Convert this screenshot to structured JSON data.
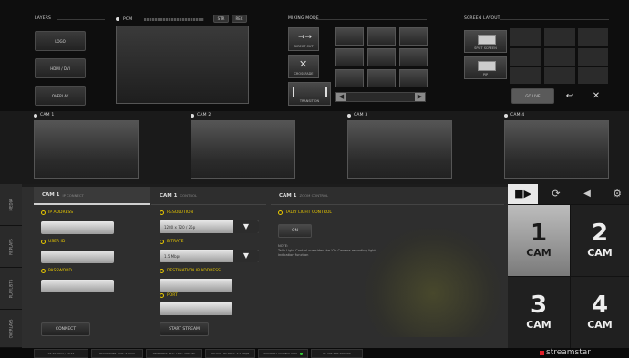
{
  "layers": {
    "title": "LAYERS",
    "buttons": [
      "LOGO",
      "HDMI / DVI",
      "OVERLAY"
    ]
  },
  "pcm": {
    "label": "PCM",
    "btn1": "STR",
    "btn2": "REC"
  },
  "mixing_mode": {
    "title": "MIXING MODE",
    "direct_cut": "DIRECT CUT",
    "crossfade": "CROSSFADE",
    "transition": "TRANSITION"
  },
  "screen_layout": {
    "title": "SCREEN LAYOUT",
    "split_screen": "SPLIT SCREEN",
    "pip": "PIP",
    "go_live": "GO LIVE"
  },
  "cameras": [
    "CAM 1",
    "CAM 2",
    "CAM 3",
    "CAM 4"
  ],
  "side_tabs": [
    "MEDIA",
    "REPLAYS",
    "PLAYLISTS",
    "OVERLAYS"
  ],
  "ip_panel": {
    "cam": "CAM 1",
    "title": "IP CONNECT",
    "ip_label": "IP ADDRESS",
    "user_label": "USER ID",
    "password_label": "PASSWORD",
    "connect": "CONNECT"
  },
  "control_panel": {
    "cam": "CAM 1",
    "title": "CONTROL",
    "resolution_label": "RESOLUTION",
    "resolution_value": "1280 x 720 / 25p",
    "bitrate_label": "BITRATE",
    "bitrate_value": "1.5 Mbps",
    "dest_label": "DESTINATION IP ADDRESS",
    "port_label": "PORT",
    "start": "START STREAM"
  },
  "zoom_panel": {
    "cam": "CAM 1",
    "title": "ZOOM CONTROL",
    "tally_label": "TALLY LIGHT CONTROL",
    "on": "ON",
    "note": "NOTE:\nTally Light Control overrides the 'On Camera recording light' indication function"
  },
  "cam_select": {
    "tiles": [
      {
        "num": "1",
        "label": "CAM"
      },
      {
        "num": "2",
        "label": "CAM"
      },
      {
        "num": "3",
        "label": "CAM"
      },
      {
        "num": "4",
        "label": "CAM"
      }
    ]
  },
  "status_bar": [
    "01.12.2013 / 18:12",
    "RECORDING TIME: 47 min",
    "AVAILABLE REC. TIME: 390 min",
    "OUTPUT BITRATE: 1.5 Mbps",
    "INTERNET CONNECTION",
    "IP: 192.168.100.100"
  ],
  "brand": "streamstar",
  "colors": {
    "accent_yellow": "#e8c800",
    "brand_red": "#e0202a",
    "background": "#0c0c0c"
  }
}
